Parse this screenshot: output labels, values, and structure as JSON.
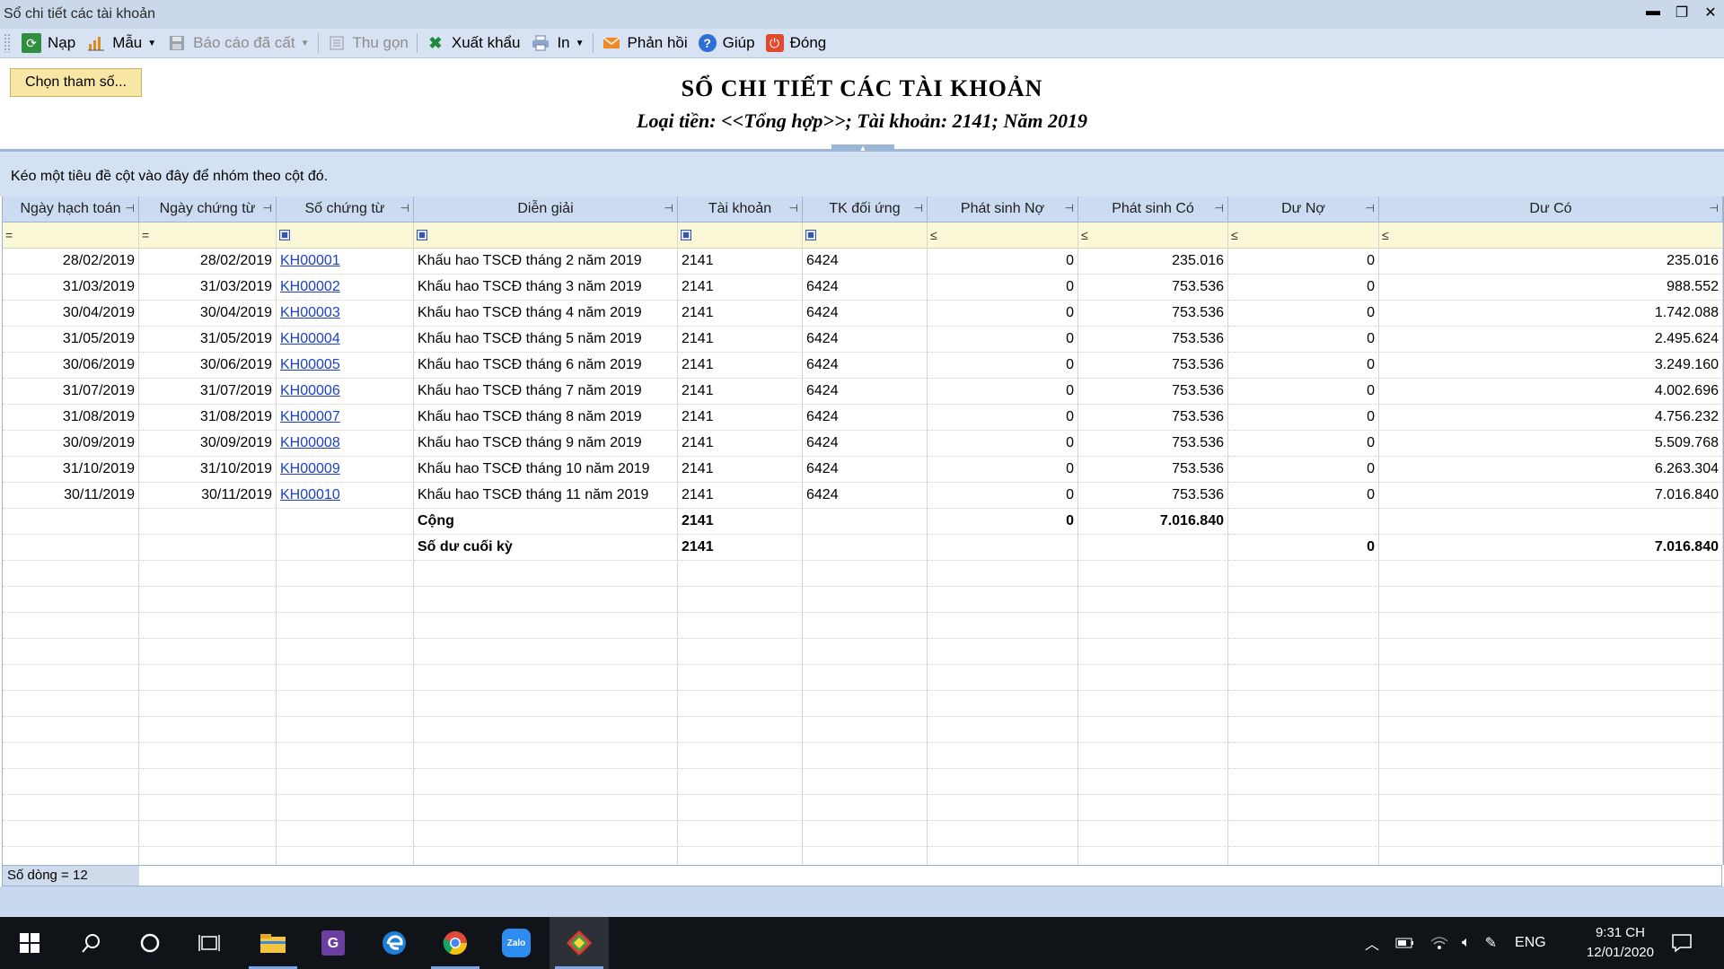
{
  "window": {
    "title": "Sổ chi tiết các tài khoản"
  },
  "toolbar": {
    "nap": "Nạp",
    "mau": "Mẫu",
    "bao_cao_da_cat": "Báo cáo đã cất",
    "thu_gon": "Thu gọn",
    "xuat_khau": "Xuất khẩu",
    "in": "In",
    "phan_hoi": "Phản hồi",
    "giup": "Giúp",
    "dong": "Đóng"
  },
  "params_button": "Chọn tham số...",
  "report": {
    "title": "SỔ CHI TIẾT CÁC TÀI KHOẢN",
    "subtitle": "Loại tiền: <<Tổng hợp>>; Tài khoản: 2141; Năm 2019"
  },
  "group_panel_text": "Kéo một tiêu đề cột vào đây để nhóm theo cột đó.",
  "columns": [
    "Ngày hạch toán",
    "Ngày chứng từ",
    "Số chứng từ",
    "Diễn giải",
    "Tài khoản",
    "TK đối ứng",
    "Phát sinh Nợ",
    "Phát sinh Có",
    "Dư Nợ",
    "Dư Có"
  ],
  "filter_ops": [
    "=",
    "=",
    "",
    "",
    "",
    "",
    "≤",
    "≤",
    "≤",
    "≤"
  ],
  "rows": [
    [
      "28/02/2019",
      "28/02/2019",
      "KH00001",
      "Khấu hao TSCĐ tháng 2 năm 2019",
      "2141",
      "6424",
      "0",
      "235.016",
      "0",
      "235.016"
    ],
    [
      "31/03/2019",
      "31/03/2019",
      "KH00002",
      "Khấu hao TSCĐ tháng 3 năm 2019",
      "2141",
      "6424",
      "0",
      "753.536",
      "0",
      "988.552"
    ],
    [
      "30/04/2019",
      "30/04/2019",
      "KH00003",
      "Khấu hao TSCĐ tháng 4 năm 2019",
      "2141",
      "6424",
      "0",
      "753.536",
      "0",
      "1.742.088"
    ],
    [
      "31/05/2019",
      "31/05/2019",
      "KH00004",
      "Khấu hao TSCĐ tháng 5 năm 2019",
      "2141",
      "6424",
      "0",
      "753.536",
      "0",
      "2.495.624"
    ],
    [
      "30/06/2019",
      "30/06/2019",
      "KH00005",
      "Khấu hao TSCĐ tháng 6 năm 2019",
      "2141",
      "6424",
      "0",
      "753.536",
      "0",
      "3.249.160"
    ],
    [
      "31/07/2019",
      "31/07/2019",
      "KH00006",
      "Khấu hao TSCĐ tháng 7 năm 2019",
      "2141",
      "6424",
      "0",
      "753.536",
      "0",
      "4.002.696"
    ],
    [
      "31/08/2019",
      "31/08/2019",
      "KH00007",
      "Khấu hao TSCĐ tháng 8 năm 2019",
      "2141",
      "6424",
      "0",
      "753.536",
      "0",
      "4.756.232"
    ],
    [
      "30/09/2019",
      "30/09/2019",
      "KH00008",
      "Khấu hao TSCĐ tháng 9 năm 2019",
      "2141",
      "6424",
      "0",
      "753.536",
      "0",
      "5.509.768"
    ],
    [
      "31/10/2019",
      "31/10/2019",
      "KH00009",
      "Khấu hao TSCĐ tháng 10 năm 2019",
      "2141",
      "6424",
      "0",
      "753.536",
      "0",
      "6.263.304"
    ],
    [
      "30/11/2019",
      "30/11/2019",
      "KH00010",
      "Khấu hao TSCĐ tháng 11 năm 2019",
      "2141",
      "6424",
      "0",
      "753.536",
      "0",
      "7.016.840"
    ]
  ],
  "total_row": [
    "",
    "",
    "",
    "Cộng",
    "2141",
    "",
    "0",
    "7.016.840",
    "",
    ""
  ],
  "closing_row": [
    "",
    "",
    "",
    "Số dư cuối kỳ",
    "2141",
    "",
    "",
    "",
    "0",
    "7.016.840"
  ],
  "row_count": "Số dòng = 12",
  "taskbar": {
    "apps": [
      "start-icon",
      "search-icon",
      "cortana-icon",
      "task-view-icon",
      "file-explorer-icon",
      "pdf-icon",
      "edge-icon",
      "chrome-icon",
      "zalo-icon",
      "misa-icon"
    ],
    "zalo_label": "Zalo",
    "language": "ENG",
    "time": "9:31 CH",
    "date": "12/01/2020"
  },
  "colors": {
    "titlebar": "#cbd8ea",
    "toolbar": "#d7e3f3",
    "header": "#cbdcf2",
    "filter": "#fbf8d8",
    "link": "#1a3fc9",
    "taskbar": "#101318"
  }
}
